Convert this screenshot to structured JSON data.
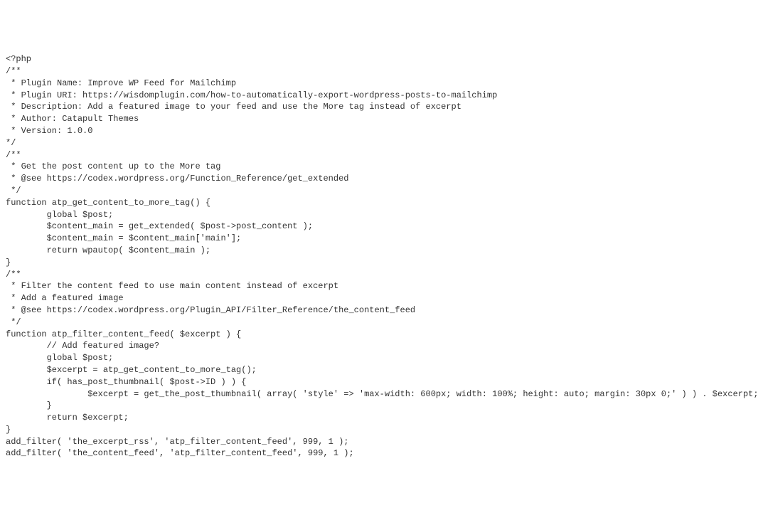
{
  "code": {
    "lines": [
      "<?php",
      "/**",
      " * Plugin Name: Improve WP Feed for Mailchimp",
      " * Plugin URI: https://wisdomplugin.com/how-to-automatically-export-wordpress-posts-to-mailchimp",
      " * Description: Add a featured image to your feed and use the More tag instead of excerpt",
      " * Author: Catapult Themes",
      " * Version: 1.0.0",
      "*/",
      "/**",
      " * Get the post content up to the More tag",
      " * @see https://codex.wordpress.org/Function_Reference/get_extended",
      " */",
      "function atp_get_content_to_more_tag() {",
      "        global $post;",
      "        $content_main = get_extended( $post->post_content );",
      "        $content_main = $content_main['main'];",
      "        return wpautop( $content_main );",
      "}",
      "/**",
      " * Filter the content feed to use main content instead of excerpt",
      " * Add a featured image",
      " * @see https://codex.wordpress.org/Plugin_API/Filter_Reference/the_content_feed",
      " */",
      "function atp_filter_content_feed( $excerpt ) {",
      "        // Add featured image?",
      "        global $post;",
      "        $excerpt = atp_get_content_to_more_tag();",
      "        if( has_post_thumbnail( $post->ID ) ) {",
      "                $excerpt = get_the_post_thumbnail( array( 'style' => 'max-width: 600px; width: 100%; height: auto; margin: 30px 0;' ) ) . $excerpt;",
      "        }",
      "        return $excerpt;",
      "}",
      "add_filter( 'the_excerpt_rss', 'atp_filter_content_feed', 999, 1 );",
      "add_filter( 'the_content_feed', 'atp_filter_content_feed', 999, 1 );"
    ]
  }
}
